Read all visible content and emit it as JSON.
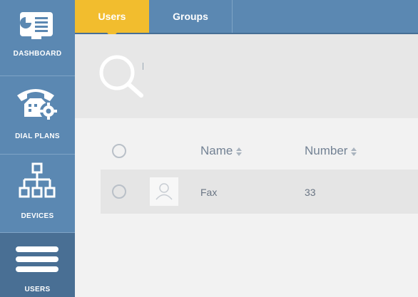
{
  "sidebar": {
    "items": [
      {
        "label": "DASHBOARD",
        "icon": "dashboard-icon"
      },
      {
        "label": "DIAL PLANS",
        "icon": "phone-gear-icon"
      },
      {
        "label": "DEVICES",
        "icon": "device-tree-icon"
      },
      {
        "label": "USERS",
        "icon": "hamburger-menu-icon",
        "active": true
      }
    ]
  },
  "tabs": [
    {
      "label": "Users",
      "active": true
    },
    {
      "label": "Groups",
      "active": false
    }
  ],
  "search": {
    "icon": "search-icon"
  },
  "table": {
    "headers": {
      "name": "Name",
      "number": "Number"
    },
    "rows": [
      {
        "name": "Fax",
        "number": "33"
      }
    ]
  },
  "colors": {
    "sidebar": "#5b88b2",
    "sidebar_active": "#496f94",
    "tab_active": "#f2bd2e"
  }
}
